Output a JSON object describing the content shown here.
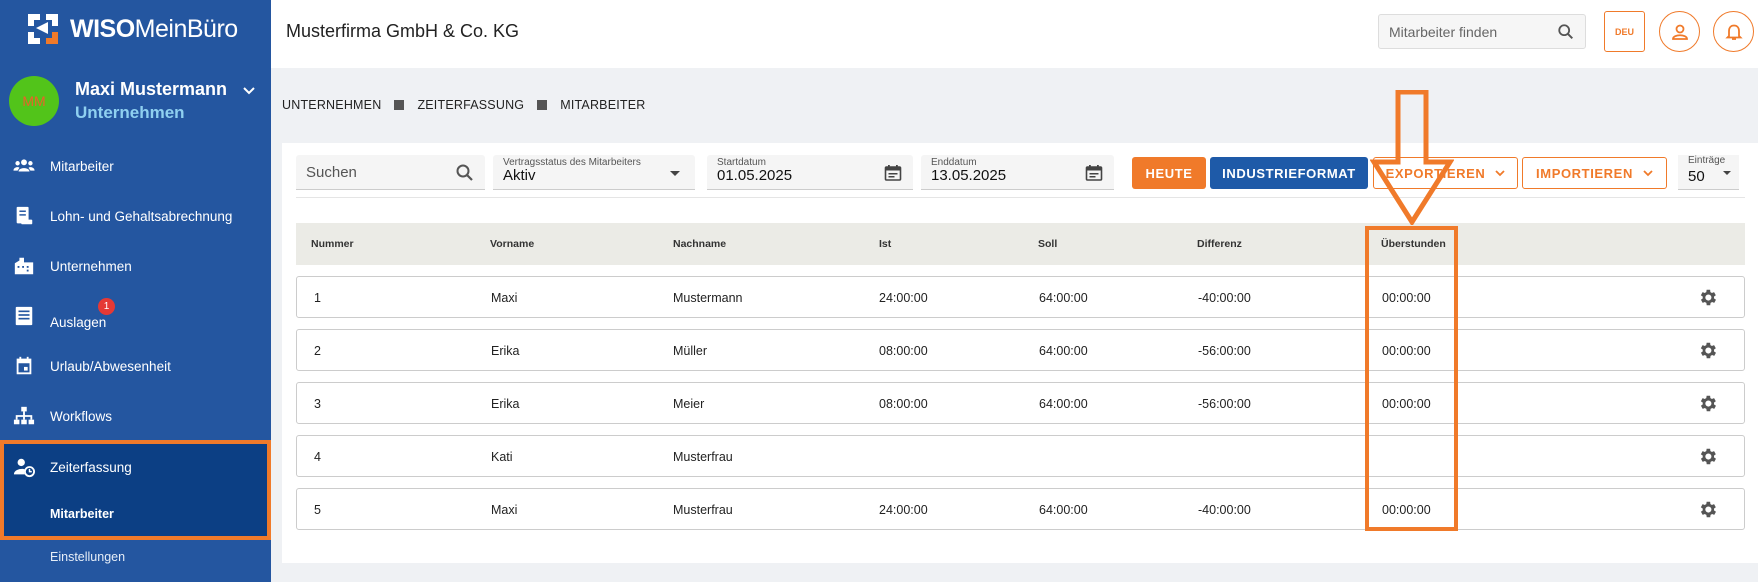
{
  "app": {
    "logo_text_bold": "WISO",
    "logo_text_light": "MeinBüro"
  },
  "user": {
    "initials": "MM",
    "name": "Maxi Mustermann",
    "role": "Unternehmen"
  },
  "sidebar": {
    "items": [
      {
        "label": "Mitarbeiter",
        "icon": "people-icon"
      },
      {
        "label": "Lohn- und Gehaltsabrechnung",
        "icon": "payroll-icon"
      },
      {
        "label": "Unternehmen",
        "icon": "building-icon"
      },
      {
        "label": "Auslagen",
        "icon": "receipt-icon",
        "badge": "1"
      },
      {
        "label": "Urlaub/Abwesenheit",
        "icon": "calendar-icon"
      },
      {
        "label": "Workflows",
        "icon": "workflow-icon"
      },
      {
        "label": "Zeiterfassung",
        "icon": "person-clock-icon"
      }
    ],
    "sub_items": [
      "Mitarbeiter",
      "Einstellungen"
    ]
  },
  "header": {
    "company": "Musterfirma GmbH & Co. KG",
    "search_placeholder": "Mitarbeiter finden",
    "language": "DEU"
  },
  "breadcrumb": [
    "UNTERNEHMEN",
    "ZEITERFASSUNG",
    "MITARBEITER"
  ],
  "filters": {
    "search_placeholder": "Suchen",
    "status_label": "Vertragsstatus des Mitarbeiters",
    "status_value": "Aktiv",
    "start_label": "Startdatum",
    "start_value": "01.05.2025",
    "end_label": "Enddatum",
    "end_value": "13.05.2025",
    "entries_label": "Einträge",
    "entries_value": "50"
  },
  "buttons": {
    "today": "HEUTE",
    "industry": "INDUSTRIEFORMAT",
    "export": "EXPORTIEREN",
    "import": "IMPORTIEREN"
  },
  "table": {
    "columns": [
      "Nummer",
      "Vorname",
      "Nachname",
      "Ist",
      "Soll",
      "Differenz",
      "Überstunden"
    ],
    "rows": [
      [
        "1",
        "Maxi",
        "Mustermann",
        "24:00:00",
        "64:00:00",
        "-40:00:00",
        "00:00:00"
      ],
      [
        "2",
        "Erika",
        "Müller",
        "08:00:00",
        "64:00:00",
        "-56:00:00",
        "00:00:00"
      ],
      [
        "3",
        "Erika",
        "Meier",
        "08:00:00",
        "64:00:00",
        "-56:00:00",
        "00:00:00"
      ],
      [
        "4",
        "Kati",
        "Musterfrau",
        "",
        "",
        "",
        ""
      ],
      [
        "5",
        "Maxi",
        "Musterfrau",
        "24:00:00",
        "64:00:00",
        "-40:00:00",
        "00:00:00"
      ]
    ]
  },
  "colors": {
    "sidebar": "#2456a0",
    "active": "#0c3f84",
    "accent": "#f07a2a",
    "primary_button": "#1e5aa8"
  }
}
